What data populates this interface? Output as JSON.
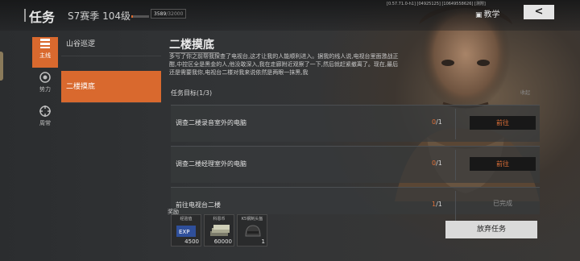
{
  "header": {
    "title": "任务",
    "season_level": "S7赛季 104级",
    "xp_progress": 0.11,
    "xp_current": "3589",
    "xp_max": "/32000",
    "sysinfo": "[0.57.71.0-h1] [04925125] [10649558626] [测附]",
    "teach_label": "教学",
    "back_label": "<"
  },
  "nav": [
    {
      "label": "主线",
      "icon": "list-icon",
      "active": true
    },
    {
      "label": "势力",
      "icon": "faction-icon",
      "active": false
    },
    {
      "label": "周常",
      "icon": "target-icon",
      "active": false
    }
  ],
  "quests": [
    {
      "label": "山谷巡逻"
    },
    {
      "label": "二楼摸底",
      "active": true
    }
  ],
  "detail": {
    "title": "二楼摸底",
    "description": "多亏了你之前帮我探查了电视台,这才让我的人能顺利进入。据我的线人说,电视台里面激战正酣,中控区全是黑金的人,他没敢深入,我在走廊附近观察了一下,然后就赶紧撤离了。现在,最后还是需要我你,电视台二楼对我来说依然是两眼一抹黑,我",
    "goal_label": "任务目标(1/3)",
    "collapse_label": "收起",
    "tasks": [
      {
        "name": "调查二楼录音室外的电脑",
        "done": "0",
        "total": "/1",
        "action": "前往"
      },
      {
        "name": "调查二楼经理室外的电脑",
        "done": "0",
        "total": "/1",
        "action": "前往"
      },
      {
        "name": "前往电视台二楼",
        "done": "1",
        "total": "/1",
        "action": "已完成"
      }
    ],
    "reward_label": "奖励",
    "rewards": [
      {
        "label": "经验值",
        "value": "4500",
        "icon": "exp-card-icon"
      },
      {
        "label": "科恩币",
        "value": "60000",
        "icon": "cash-stack-icon"
      },
      {
        "label": "K5钢制头盔",
        "value": "1",
        "icon": "helmet-icon"
      }
    ],
    "abandon_label": "放弃任务"
  },
  "colors": {
    "accent": "#d9692e",
    "progress_text": "#e07038"
  }
}
